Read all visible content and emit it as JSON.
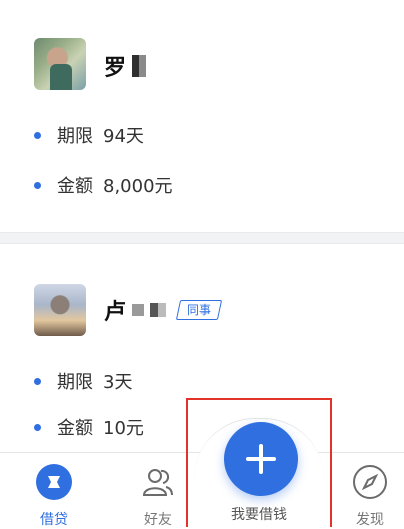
{
  "loans": [
    {
      "name": "罗",
      "tag": "",
      "rows": [
        {
          "key": "期限",
          "value": "94天"
        },
        {
          "key": "金额",
          "value": "8,000元"
        }
      ]
    },
    {
      "name": "卢",
      "tag": "同事",
      "rows": [
        {
          "key": "期限",
          "value": "3天"
        },
        {
          "key": "金额",
          "value": "10元"
        }
      ]
    }
  ],
  "tabbar": {
    "loan": "借贷",
    "friends": "好友",
    "borrow": "我要借钱",
    "discover": "发现"
  },
  "colors": {
    "accent": "#2f6fe0",
    "highlight": "#e2332b"
  }
}
